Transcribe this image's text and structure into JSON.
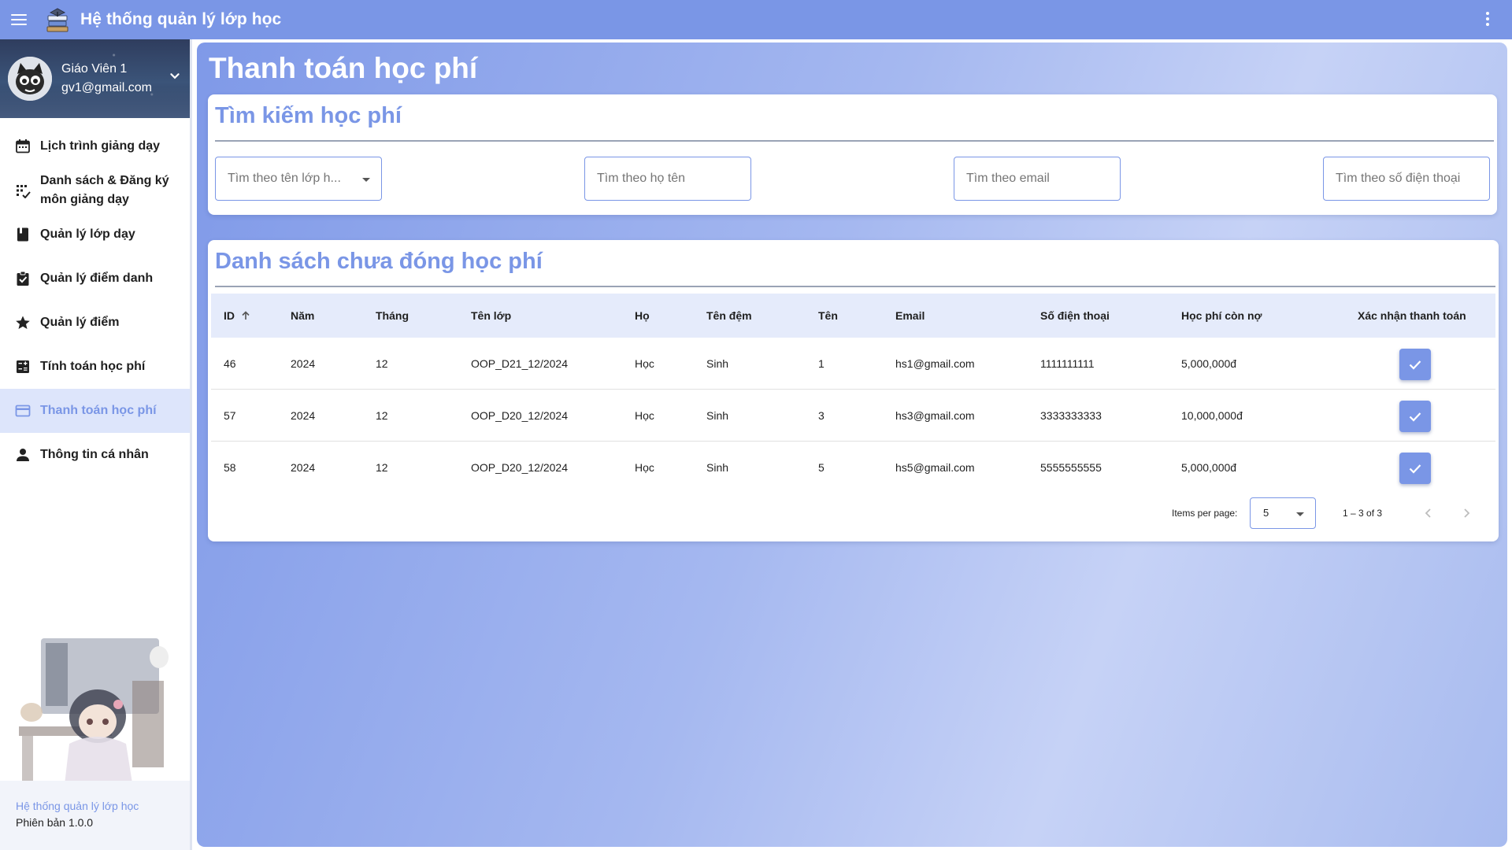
{
  "app": {
    "title": "Hệ thống quản lý lớp học"
  },
  "topbar": {
    "menu_icon": "menu-icon",
    "logo_icon": "books-logo-icon",
    "more_icon": "more-vert-icon"
  },
  "profile": {
    "name": "Giáo Viên 1",
    "email": "gv1@gmail.com"
  },
  "sidebar": {
    "items": [
      {
        "label": "Lịch trình giảng dạy",
        "icon": "calendar-icon",
        "active": false
      },
      {
        "label": "Danh sách & Đăng ký môn giảng dạy",
        "icon": "grid-list-icon",
        "active": false
      },
      {
        "label": "Quản lý lớp dạy",
        "icon": "book-icon",
        "active": false
      },
      {
        "label": "Quản lý điểm danh",
        "icon": "clipboard-check-icon",
        "active": false
      },
      {
        "label": "Quản lý điểm",
        "icon": "star-icon",
        "active": false
      },
      {
        "label": "Tính toán học phí",
        "icon": "calculator-icon",
        "active": false
      },
      {
        "label": "Thanh toán học phí",
        "icon": "credit-card-icon",
        "active": true
      },
      {
        "label": "Thông tin cá nhân",
        "icon": "person-icon",
        "active": false
      }
    ],
    "footer_title": "Hệ thống quản lý lớp học",
    "footer_version": "Phiên bản 1.0.0"
  },
  "page": {
    "title": "Thanh toán học phí"
  },
  "search": {
    "title": "Tìm kiếm học phí",
    "class_placeholder": "Tìm theo tên lớp h...",
    "name_placeholder": "Tìm theo họ tên",
    "email_placeholder": "Tìm theo email",
    "phone_placeholder": "Tìm theo số điện thoại"
  },
  "table": {
    "title": "Danh sách chưa đóng học phí",
    "columns": [
      "ID",
      "Năm",
      "Tháng",
      "Tên lớp",
      "Họ",
      "Tên đệm",
      "Tên",
      "Email",
      "Số điện thoại",
      "Học phí còn nợ",
      "Xác nhận thanh toán"
    ],
    "sort_icon": "arrow-up-icon",
    "rows": [
      [
        "46",
        "2024",
        "12",
        "OOP_D21_12/2024",
        "Học",
        "Sinh",
        "1",
        "hs1@gmail.com",
        "1111111111",
        "5,000,000đ"
      ],
      [
        "57",
        "2024",
        "12",
        "OOP_D20_12/2024",
        "Học",
        "Sinh",
        "3",
        "hs3@gmail.com",
        "3333333333",
        "10,000,000đ"
      ],
      [
        "58",
        "2024",
        "12",
        "OOP_D20_12/2024",
        "Học",
        "Sinh",
        "5",
        "hs5@gmail.com",
        "5555555555",
        "5,000,000đ"
      ]
    ]
  },
  "paginator": {
    "items_label": "Items per page:",
    "page_size": "5",
    "range": "1 – 3 of 3"
  },
  "colors": {
    "accent": "#7a96e6",
    "active_bg": "#dde5fb",
    "header_row": "#e5ebfb"
  }
}
